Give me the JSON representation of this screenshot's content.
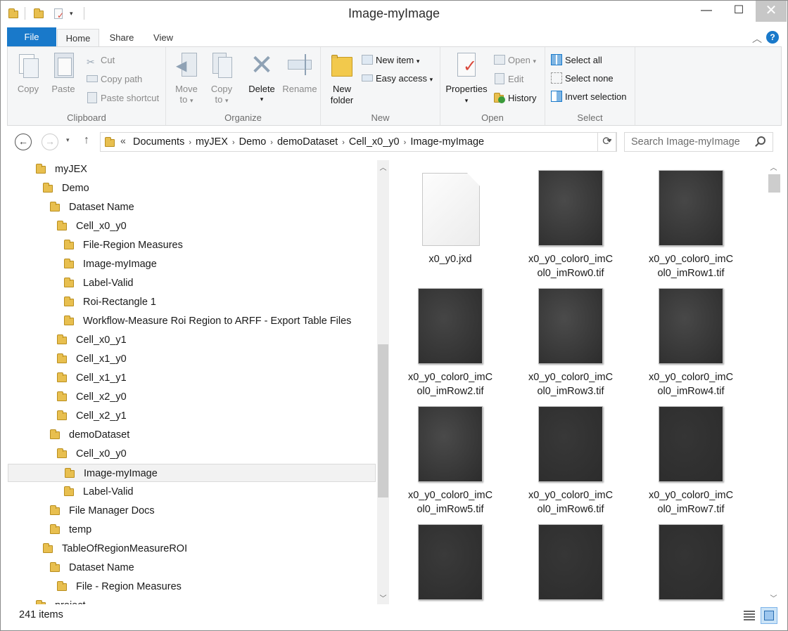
{
  "window": {
    "title": "Image-myImage",
    "minimize": "—",
    "maximize": "☐",
    "close": "✕"
  },
  "tabs": [
    "File",
    "Home",
    "Share",
    "View"
  ],
  "ribbon": {
    "clipboard": {
      "label": "Clipboard",
      "copy": "Copy",
      "paste": "Paste",
      "cut": "Cut",
      "copy_path": "Copy path",
      "paste_shortcut": "Paste shortcut"
    },
    "organize": {
      "label": "Organize",
      "move_to_1": "Move",
      "move_to_2": "to",
      "copy_to_1": "Copy",
      "copy_to_2": "to",
      "delete": "Delete",
      "rename": "Rename"
    },
    "new": {
      "label": "New",
      "new_folder_1": "New",
      "new_folder_2": "folder",
      "new_item": "New item",
      "easy_access": "Easy access"
    },
    "open": {
      "label": "Open",
      "properties": "Properties",
      "open": "Open",
      "edit": "Edit",
      "history": "History"
    },
    "select": {
      "label": "Select",
      "select_all": "Select all",
      "select_none": "Select none",
      "invert_selection": "Invert selection"
    }
  },
  "address": {
    "overflow": "«",
    "crumbs": [
      "Documents",
      "myJEX",
      "Demo",
      "demoDataset",
      "Cell_x0_y0",
      "Image-myImage"
    ],
    "search_placeholder": "Search Image-myImage"
  },
  "tree": [
    {
      "label": "myJEX",
      "depth": 0
    },
    {
      "label": "Demo",
      "depth": 1
    },
    {
      "label": "Dataset Name",
      "depth": 2
    },
    {
      "label": "Cell_x0_y0",
      "depth": 3
    },
    {
      "label": "File-Region Measures",
      "depth": 4
    },
    {
      "label": "Image-myImage",
      "depth": 4
    },
    {
      "label": "Label-Valid",
      "depth": 4
    },
    {
      "label": "Roi-Rectangle 1",
      "depth": 4
    },
    {
      "label": "Workflow-Measure Roi Region to ARFF - Export Table Files",
      "depth": 4
    },
    {
      "label": "Cell_x0_y1",
      "depth": 3
    },
    {
      "label": "Cell_x1_y0",
      "depth": 3
    },
    {
      "label": "Cell_x1_y1",
      "depth": 3
    },
    {
      "label": "Cell_x2_y0",
      "depth": 3
    },
    {
      "label": "Cell_x2_y1",
      "depth": 3
    },
    {
      "label": "demoDataset",
      "depth": 2
    },
    {
      "label": "Cell_x0_y0",
      "depth": 3
    },
    {
      "label": "Image-myImage",
      "depth": 4,
      "selected": true
    },
    {
      "label": "Label-Valid",
      "depth": 4
    },
    {
      "label": "File Manager Docs",
      "depth": 2
    },
    {
      "label": "temp",
      "depth": 2
    },
    {
      "label": "TableOfRegionMeasureROI",
      "depth": 1
    },
    {
      "label": "Dataset Name",
      "depth": 2
    },
    {
      "label": "File - Region Measures",
      "depth": 3
    },
    {
      "label": "project",
      "depth": 0
    }
  ],
  "files": [
    {
      "line1": "x0_y0.jxd",
      "line2": "",
      "kind": "doc"
    },
    {
      "line1": "x0_y0_color0_imC",
      "line2": "ol0_imRow0.tif",
      "kind": "img",
      "shade": "#4a4a4a"
    },
    {
      "line1": "x0_y0_color0_imC",
      "line2": "ol0_imRow1.tif",
      "kind": "img",
      "shade": "#474747"
    },
    {
      "line1": "x0_y0_color0_imC",
      "line2": "ol0_imRow2.tif",
      "kind": "img",
      "shade": "#454545"
    },
    {
      "line1": "x0_y0_color0_imC",
      "line2": "ol0_imRow3.tif",
      "kind": "img",
      "shade": "#4b4b4b"
    },
    {
      "line1": "x0_y0_color0_imC",
      "line2": "ol0_imRow4.tif",
      "kind": "img",
      "shade": "#484848"
    },
    {
      "line1": "x0_y0_color0_imC",
      "line2": "ol0_imRow5.tif",
      "kind": "img",
      "shade": "#4a4a4a"
    },
    {
      "line1": "x0_y0_color0_imC",
      "line2": "ol0_imRow6.tif",
      "kind": "img",
      "shade": "#383838"
    },
    {
      "line1": "x0_y0_color0_imC",
      "line2": "ol0_imRow7.tif",
      "kind": "img",
      "shade": "#353535"
    },
    {
      "line1": "",
      "line2": "",
      "kind": "img",
      "shade": "#3a3a3a"
    },
    {
      "line1": "",
      "line2": "",
      "kind": "img",
      "shade": "#363636"
    },
    {
      "line1": "",
      "line2": "",
      "kind": "img",
      "shade": "#343434"
    }
  ],
  "status": {
    "count": "241 items"
  }
}
